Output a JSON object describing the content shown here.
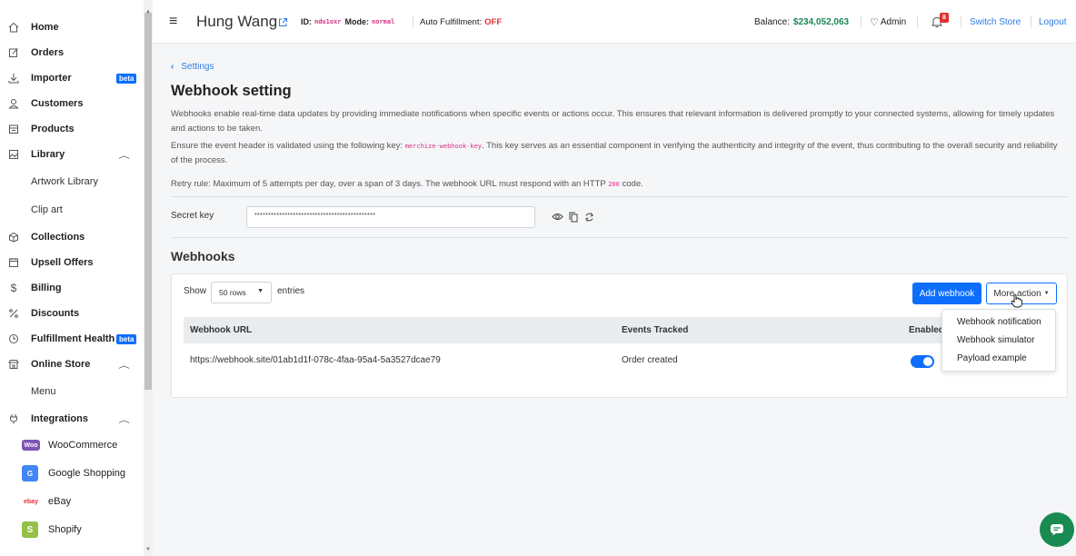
{
  "sidebar": {
    "items": [
      {
        "label": "Home",
        "icon": "home-icon"
      },
      {
        "label": "Orders",
        "icon": "edit-icon"
      },
      {
        "label": "Importer",
        "icon": "download-icon",
        "badge": "beta"
      },
      {
        "label": "Customers",
        "icon": "user-icon"
      },
      {
        "label": "Products",
        "icon": "box-icon"
      },
      {
        "label": "Library",
        "icon": "image-icon"
      },
      {
        "label": "Artwork Library"
      },
      {
        "label": "Clip art"
      },
      {
        "label": "Collections",
        "icon": "collection-icon"
      },
      {
        "label": "Upsell Offers",
        "icon": "calendar-icon"
      },
      {
        "label": "Billing",
        "icon": "dollar-icon"
      },
      {
        "label": "Discounts",
        "icon": "tag-icon"
      },
      {
        "label": "Fulfillment Health",
        "icon": "clock-icon",
        "badge": "beta"
      },
      {
        "label": "Online Store",
        "icon": "store-icon"
      },
      {
        "label": "Menu"
      },
      {
        "label": "Integrations",
        "icon": "plug-icon"
      },
      {
        "label": "WooCommerce",
        "logo": "Woo"
      },
      {
        "label": "Google Shopping",
        "logo": "G"
      },
      {
        "label": "eBay",
        "logo": "ebay"
      },
      {
        "label": "Shopify",
        "logo": "S"
      }
    ]
  },
  "topbar": {
    "menu_icon": "≡",
    "user_name": "Hung Wang",
    "id_label": "ID:",
    "id_value": "ndu1oxr",
    "mode_label": "Mode:",
    "mode_value": "normal",
    "auto_label": "Auto Fulfillment:",
    "auto_value": "OFF",
    "balance_label": "Balance:",
    "balance_value": "$234,052,063",
    "admin_label": "Admin",
    "notif_count": "8",
    "switch_store": "Switch Store",
    "logout": "Logout"
  },
  "page": {
    "back_label": "Settings",
    "title": "Webhook setting",
    "desc1": "Webhooks enable real-time data updates by providing immediate notifications when specific events or actions occur. This ensures that relevant information is delivered promptly to your connected systems, allowing for timely updates and actions to be taken.",
    "desc2_pre": "Ensure the event header is validated using the following key:",
    "desc2_code": "merchize-webhook-key",
    "desc2_post": ". This key serves as an essential component in verifying the authenticity and integrity of the event, thus contributing to the overall security and reliability of the process.",
    "desc3_pre": "Retry rule: Maximum of 5 attempts per day, over a span of 3 days. The webhook URL must respond with an HTTP",
    "desc3_code": "200",
    "desc3_post": "code.",
    "secret_label": "Secret key",
    "secret_value": "********************************************",
    "webhooks_title": "Webhooks"
  },
  "table": {
    "show_label": "Show",
    "rows_select": "50 rows",
    "entries_label": "entries",
    "add_button": "Add webhook",
    "more_button": "More action",
    "columns": [
      "Webhook URL",
      "Events Tracked",
      "Enabled"
    ],
    "rows": [
      {
        "url": "https://webhook.site/01ab1d1f-078c-4faa-95a4-5a3527dcae79",
        "events": "Order created",
        "enabled": true
      }
    ]
  },
  "dropdown": {
    "items": [
      "Webhook notification",
      "Webhook simulator",
      "Payload example"
    ]
  },
  "colors": {
    "primary": "#0d6efd",
    "link": "#2d7be5",
    "balance": "#198754",
    "off": "#e03131",
    "chat": "#198a52"
  }
}
